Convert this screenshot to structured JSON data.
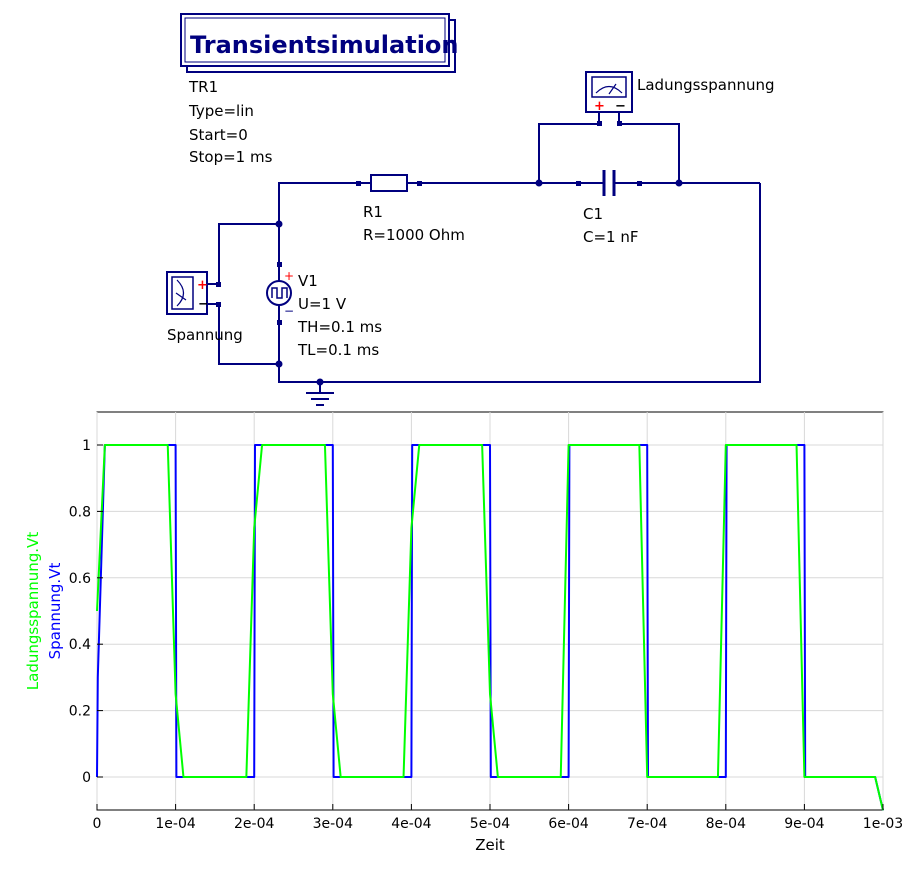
{
  "colors": {
    "wire": "#00007f",
    "plus": "#ff0000",
    "series_spannung": "#0000ff",
    "series_ladung": "#00ff00",
    "grid": "#d8d8d8"
  },
  "schematic": {
    "sim_title": "Transientsimulation",
    "tr": [
      "TR1",
      "Type=lin",
      "Start=0",
      "Stop=1 ms"
    ],
    "r1": [
      "R1",
      "R=1000 Ohm"
    ],
    "c1": [
      "C1",
      "C=1 nF"
    ],
    "v1": [
      "V1",
      "U=1 V",
      "TH=0.1 ms",
      "TL=0.1 ms"
    ],
    "probe_top_label": "Ladungsspannung",
    "probe_left_label": "Spannung",
    "plus_sign": "+",
    "minus_sign": "−"
  },
  "chart_data": {
    "type": "line",
    "xlabel": "Zeit",
    "ylabel_series": [
      "Ladungsspannung.Vt",
      "Spannung.Vt"
    ],
    "xlim": [
      0,
      0.001
    ],
    "ylim": [
      -0.1,
      1.1
    ],
    "xticks": [
      0,
      0.0001,
      0.0002,
      0.0003,
      0.0004,
      0.0005,
      0.0006,
      0.0007,
      0.0008,
      0.0009,
      0.001
    ],
    "xtick_labels": [
      "0",
      "1e-04",
      "2e-04",
      "3e-04",
      "4e-04",
      "5e-04",
      "6e-04",
      "7e-04",
      "8e-04",
      "9e-04",
      "1e-03"
    ],
    "yticks": [
      0,
      0.2,
      0.4,
      0.6,
      0.8,
      1
    ],
    "ytick_labels": [
      "0",
      "0.2",
      "0.4",
      "0.6",
      "0.8",
      "1"
    ],
    "grid": true,
    "series": [
      {
        "name": "Spannung.Vt",
        "color": "#0000ff",
        "x": [
          0,
          1e-06,
          1e-05,
          0.0001,
          0.000101,
          0.0002,
          0.000201,
          0.0003,
          0.000301,
          0.0004,
          0.000401,
          0.0005,
          0.000501,
          0.0006,
          0.000601,
          0.0007,
          0.000701,
          0.0008,
          0.000801,
          0.0009,
          0.000901,
          0.00099,
          0.001
        ],
        "y": [
          0,
          0.3,
          1,
          1,
          0,
          0,
          1,
          1,
          0,
          0,
          1,
          1,
          0,
          0,
          1,
          1,
          0,
          0,
          1,
          1,
          0,
          0,
          -0.1
        ]
      },
      {
        "name": "Ladungsspannung.Vt",
        "color": "#00ff00",
        "x": [
          0,
          1e-05,
          9e-05,
          0.0001,
          0.00011,
          0.00019,
          0.0002,
          0.00021,
          0.00029,
          0.0003,
          0.00031,
          0.00039,
          0.0004,
          0.00041,
          0.00049,
          0.0005,
          0.00051,
          0.00059,
          0.0006,
          0.00061,
          0.00069,
          0.0007,
          0.00071,
          0.00079,
          0.0008,
          0.00081,
          0.00089,
          0.0009,
          0.00091,
          0.00099,
          0.001
        ],
        "y": [
          0.5,
          1,
          1,
          0.25,
          0,
          0,
          0.75,
          1,
          1,
          0.25,
          0,
          0,
          0.75,
          1,
          1,
          0.25,
          0,
          0,
          1,
          1,
          1,
          0,
          0,
          0,
          1,
          1,
          1,
          0,
          0,
          0,
          -0.1
        ]
      }
    ]
  }
}
